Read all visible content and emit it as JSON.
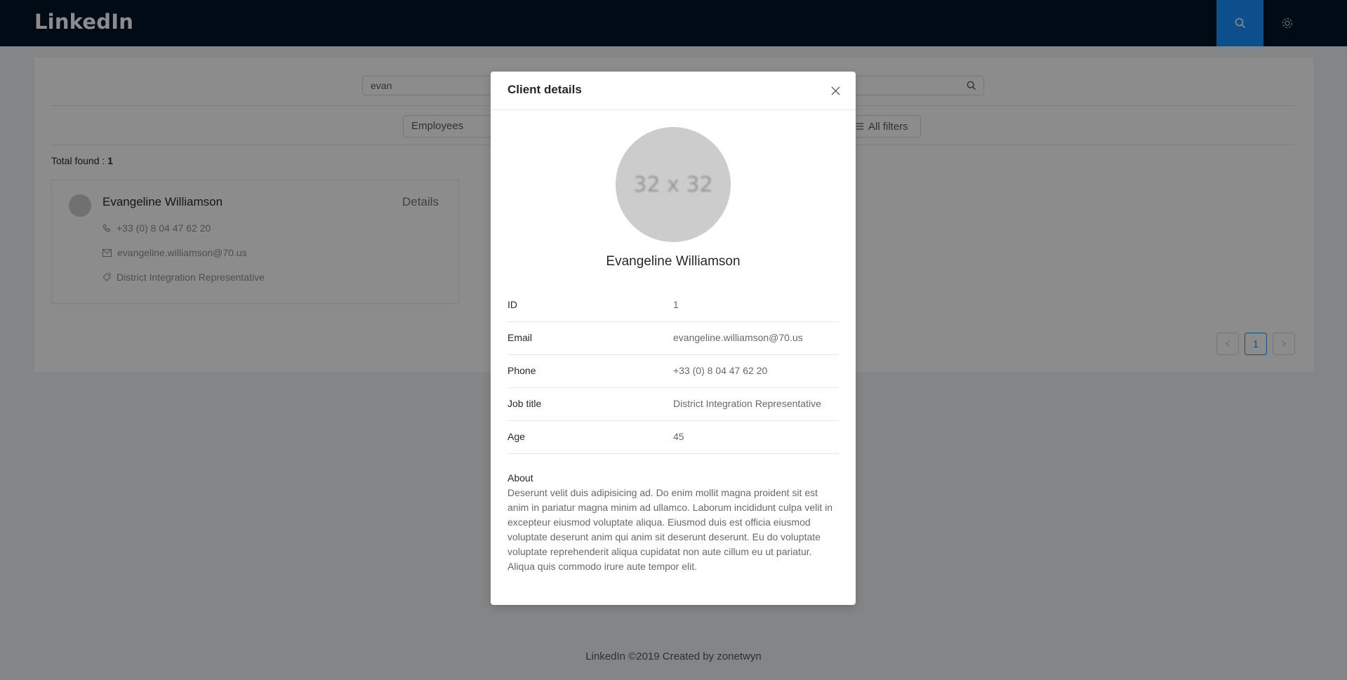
{
  "header": {
    "logo": "LinkedIn",
    "search_icon": "search-icon",
    "settings_icon": "gear-icon"
  },
  "search": {
    "value": "evan"
  },
  "filters": {
    "type_value": "Employees",
    "all_filters_label": "All filters"
  },
  "results": {
    "total_label": "Total found : ",
    "total_count": "1",
    "card": {
      "name": "Evangeline Williamson",
      "details_label": "Details",
      "phone": "+33 (0) 8 04 47 62 20",
      "email": "evangeline.williamson@70.us",
      "job": "District Integration Representative"
    }
  },
  "pagination": {
    "current": "1"
  },
  "footer": {
    "text": "LinkedIn ©2019 Created by zonetwyn"
  },
  "modal": {
    "title": "Client details",
    "avatar_placeholder": "32 x 32",
    "name": "Evangeline Williamson",
    "fields": [
      {
        "label": "ID",
        "value": "1"
      },
      {
        "label": "Email",
        "value": "evangeline.williamson@70.us"
      },
      {
        "label": "Phone",
        "value": "+33 (0) 8 04 47 62 20"
      },
      {
        "label": "Job title",
        "value": "District Integration Representative"
      },
      {
        "label": "Age",
        "value": "45"
      }
    ],
    "about_label": "About",
    "about_text": "Deserunt velit duis adipisicing ad. Do enim mollit magna proident sit est anim in pariatur magna minim ad ullamco. Laborum incididunt culpa velit in excepteur eiusmod voluptate aliqua. Eiusmod duis est officia eiusmod voluptate deserunt anim qui anim sit deserunt deserunt. Eu do voluptate voluptate reprehenderit aliqua cupidatat non aute cillum eu ut pariatur. Aliqua quis commodo irure aute tempor elit."
  },
  "colors": {
    "header_bg": "#001529",
    "accent": "#1890ff"
  }
}
